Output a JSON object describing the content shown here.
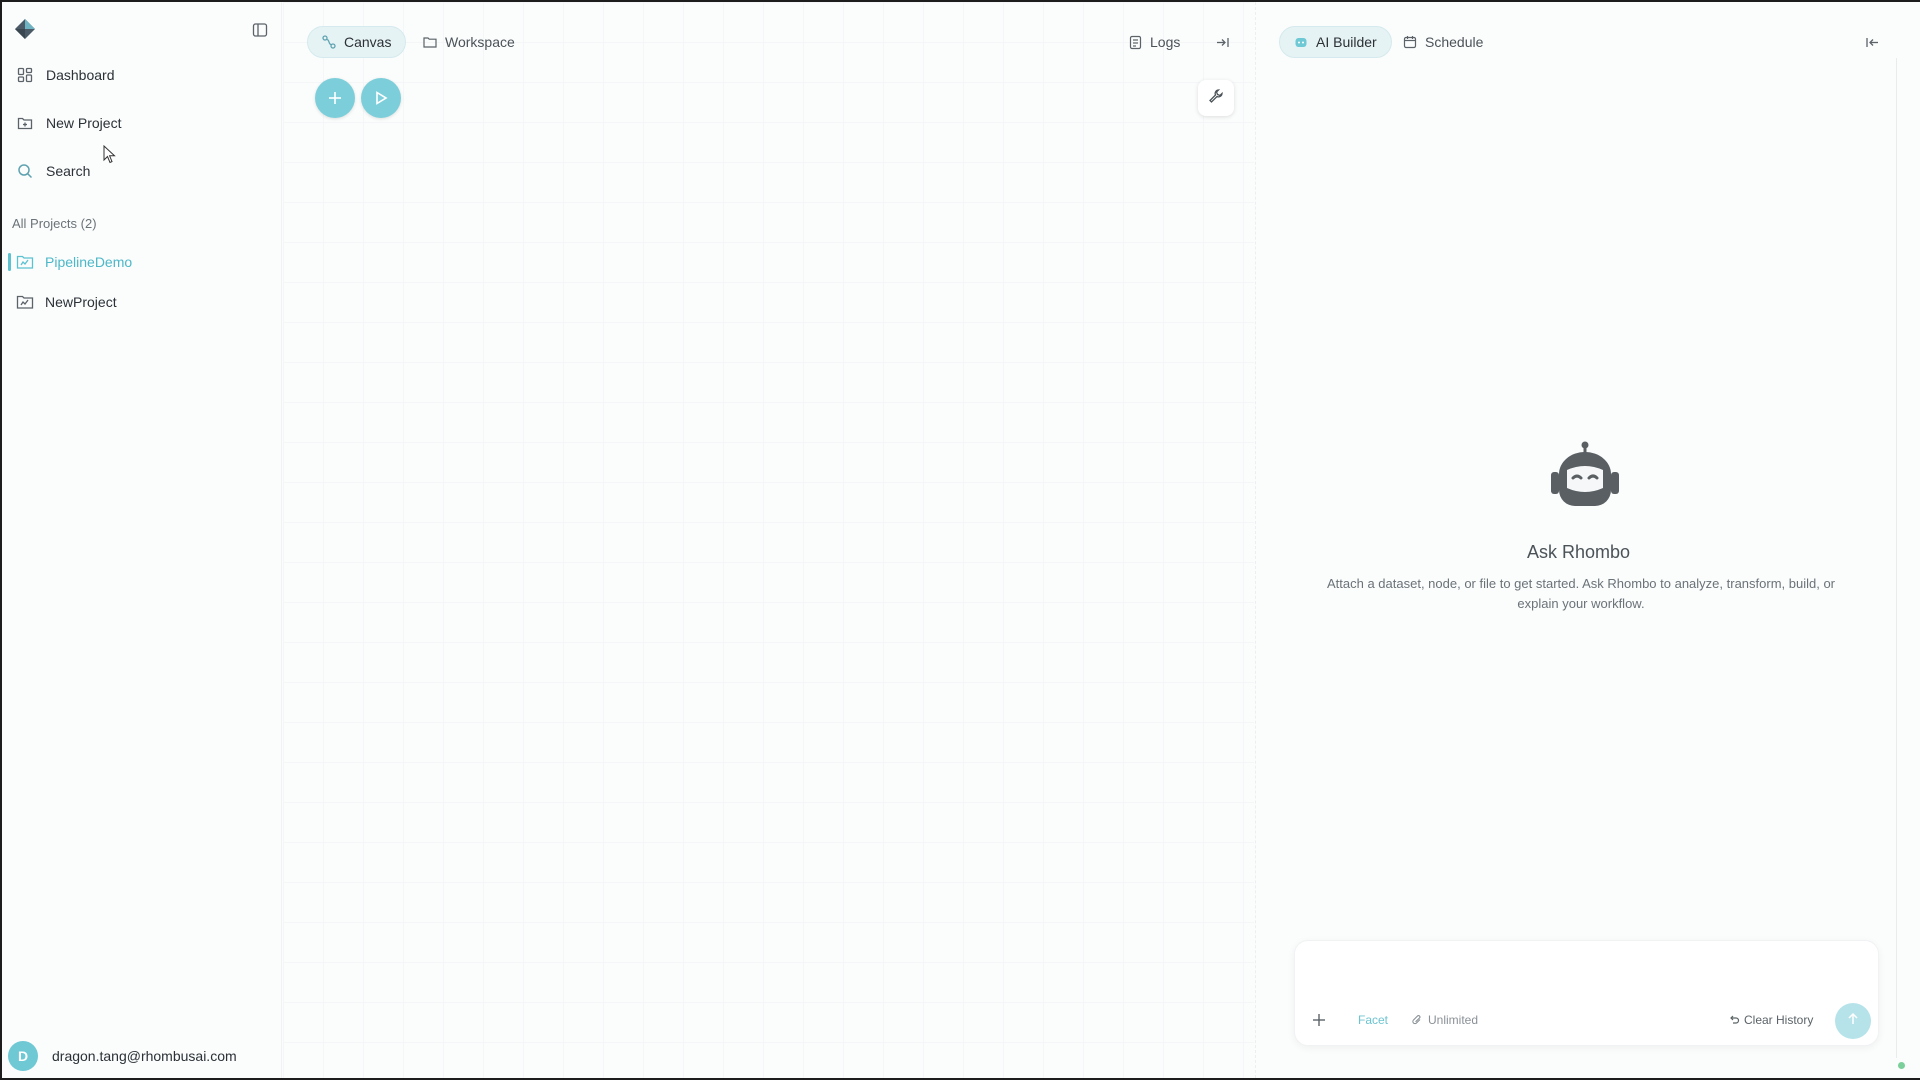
{
  "sidebar": {
    "nav": [
      {
        "label": "Dashboard",
        "icon": "dashboard-icon"
      },
      {
        "label": "New Project",
        "icon": "new-project-icon"
      },
      {
        "label": "Search",
        "icon": "search-icon"
      }
    ],
    "projects_title": "All Projects (2)",
    "projects": [
      {
        "label": "PipelineDemo",
        "active": true
      },
      {
        "label": "NewProject",
        "active": false
      }
    ],
    "user": {
      "initial": "D",
      "email": "dragon.tang@rhombusai.com"
    }
  },
  "main": {
    "tabs": [
      {
        "label": "Canvas",
        "active": true,
        "icon": "canvas-icon"
      },
      {
        "label": "Workspace",
        "active": false,
        "icon": "folder-icon"
      }
    ],
    "logs_label": "Logs"
  },
  "panel": {
    "tabs": [
      {
        "label": "AI Builder",
        "active": true,
        "icon": "robot-icon"
      },
      {
        "label": "Schedule",
        "active": false,
        "icon": "calendar-icon"
      }
    ],
    "title": "Ask Rhombo",
    "description": "Attach a dataset, node, or file to get started. Ask Rhombo to analyze, transform, build, or explain your workflow.",
    "composer": {
      "facet_label": "Facet",
      "unlimited_label": "Unlimited",
      "clear_label": "Clear History"
    }
  },
  "colors": {
    "accent": "#5cc2d0",
    "accent_light": "#e6f3f5",
    "background": "#fbfcfc"
  }
}
